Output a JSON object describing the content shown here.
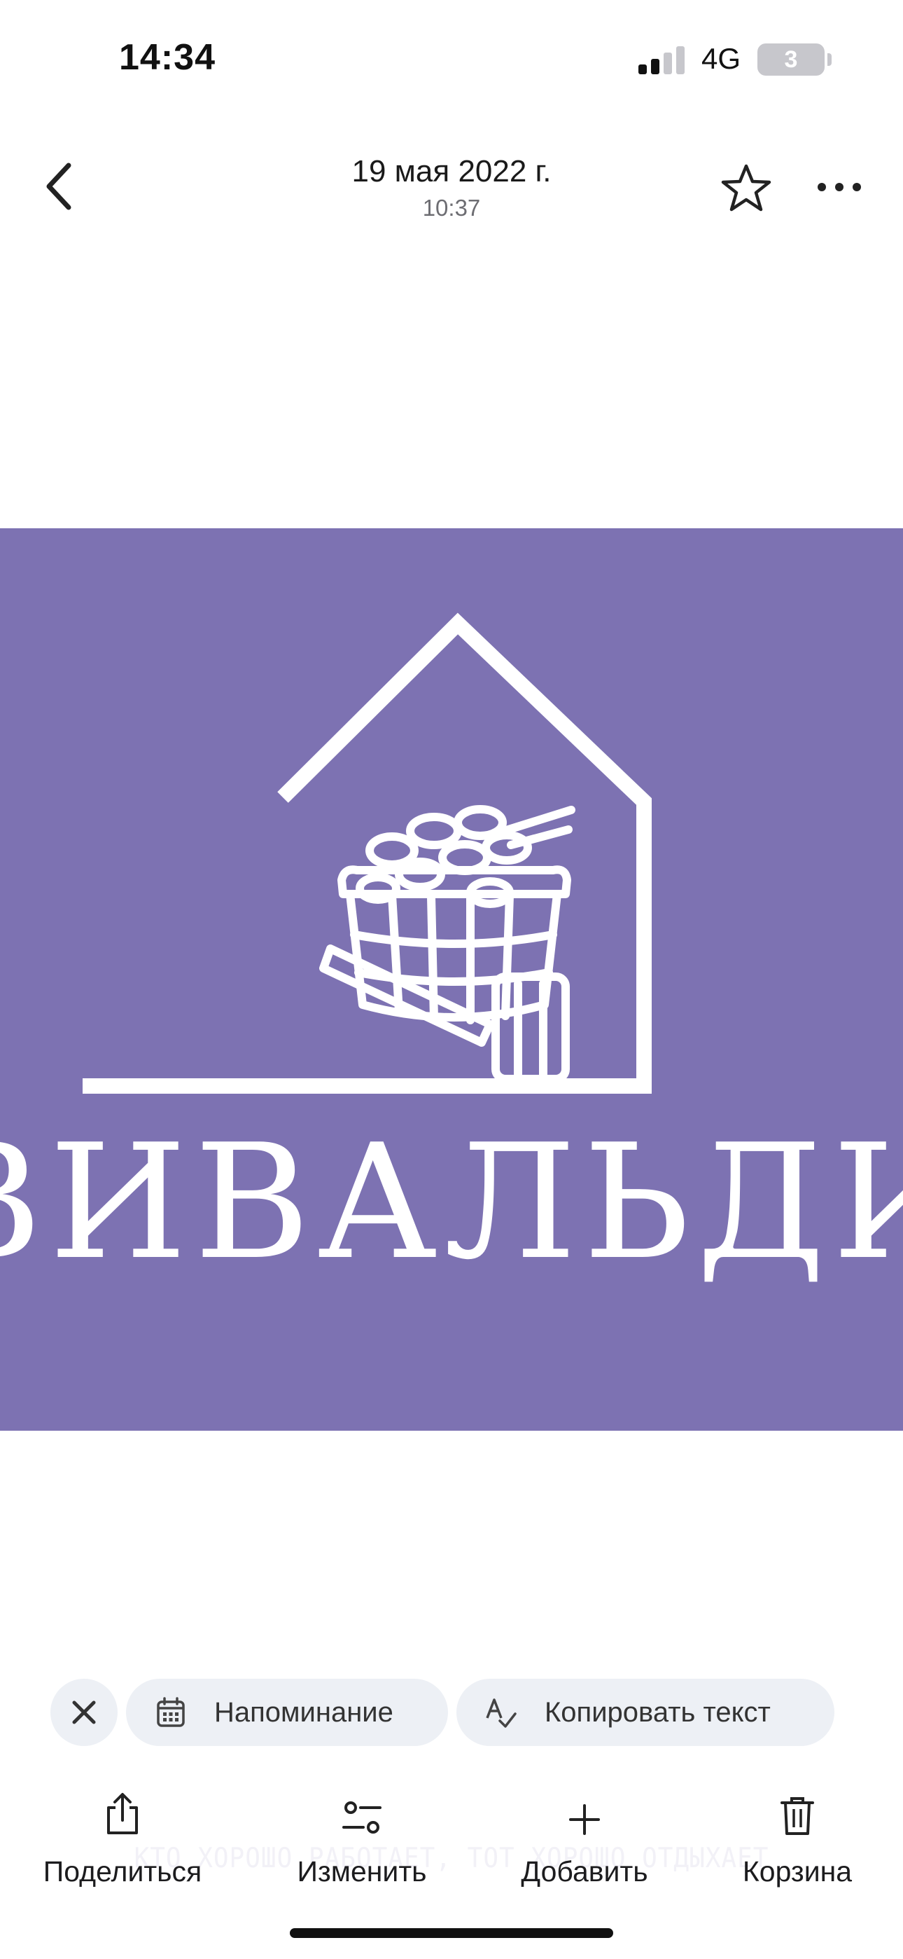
{
  "status_bar": {
    "time": "14:34",
    "network": "4G",
    "battery": "3"
  },
  "header": {
    "date": "19 мая 2022 г.",
    "time": "10:37"
  },
  "image": {
    "logo_title": "ВИВАЛЬДИ",
    "tagline": "КТО ХОРОШО РАБОТАЕТ, ТОТ ХОРОШО ОТДЫХАЕТ",
    "background_color": "#7d72b2"
  },
  "chips": {
    "reminder": "Напоминание",
    "copy_text": "Копировать текст"
  },
  "actions": {
    "share": "Поделиться",
    "edit": "Изменить",
    "add": "Добавить",
    "trash": "Корзина"
  }
}
